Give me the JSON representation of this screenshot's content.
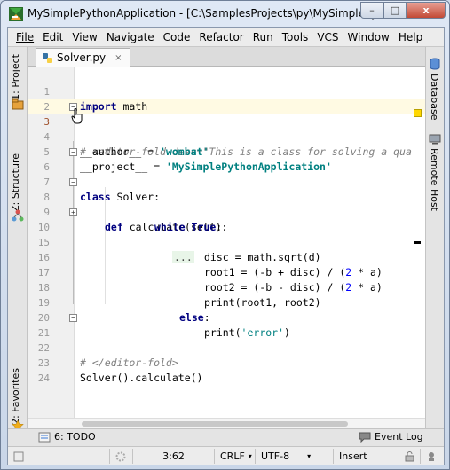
{
  "window": {
    "title": "MySimplePythonApplication - [C:\\SamplesProjects\\py\\MySimplePyt...",
    "minimize": "–",
    "maximize": "□",
    "close": "x"
  },
  "menu": {
    "items": [
      "File",
      "Edit",
      "View",
      "Navigate",
      "Code",
      "Refactor",
      "Run",
      "Tools",
      "VCS",
      "Window",
      "Help"
    ]
  },
  "left_tools": {
    "project": "1: Project",
    "structure": "Z: Structure",
    "favorites": "2: Favorites"
  },
  "right_tools": {
    "database": "Database",
    "remote_host": "Remote Host"
  },
  "editor_tab": {
    "label": "Solver.py",
    "close": "×"
  },
  "code": {
    "lines": [
      {
        "n": "1",
        "text": "import math"
      },
      {
        "n": "2",
        "text": ""
      },
      {
        "n": "3",
        "text": "# <editor-fold desc=\"This is a class for solving a qua"
      },
      {
        "n": "4",
        "text": "__author__ = 'wombat'"
      },
      {
        "n": "5",
        "text": "__project__ = 'MySimplePythonApplication'"
      },
      {
        "n": "6",
        "text": "class Solver:"
      },
      {
        "n": "7",
        "text": ""
      },
      {
        "n": "8",
        "text": "    def calculate(self):"
      },
      {
        "n": "9",
        "text": "        while True:"
      },
      {
        "n": "10",
        "text": "..."
      },
      {
        "n": "15",
        "text": "disc = math.sqrt(d)"
      },
      {
        "n": "16",
        "text": "root1 = (-b + disc) / (2 * a)"
      },
      {
        "n": "17",
        "text": "root2 = (-b - disc) / (2 * a)"
      },
      {
        "n": "18",
        "text": "print(root1, root2)"
      },
      {
        "n": "19",
        "text": "else:"
      },
      {
        "n": "20",
        "text": "print('error')"
      },
      {
        "n": "21",
        "text": "# </editor-fold>"
      },
      {
        "n": "22",
        "text": ""
      },
      {
        "n": "23",
        "text": "Solver().calculate()"
      },
      {
        "n": "24",
        "text": ""
      }
    ],
    "frag": {
      "import_kw": "import",
      "import_rest": " math",
      "fold_comment": "# <editor-fold desc=\"This is a class for solving a qua",
      "author_name": "__author__",
      "author_eq": " = ",
      "author_val": "'wombat'",
      "project_name": "__project__",
      "project_eq": " = ",
      "project_val": "'MySimplePythonApplication'",
      "class_kw": "class",
      "class_rest": " Solver:",
      "def_kw": "def",
      "def_rest": " calculate(self):",
      "while_kw": "while",
      "true_kw": " True",
      "while_colon": ":",
      "dots": "...",
      "disc": "disc = math.sqrt(d)",
      "root1_a": "root1 = (-b + disc) / (",
      "root1_2": "2",
      "root1_b": " * a)",
      "root2_a": "root2 = (-b - disc) / (",
      "root2_2": "2",
      "root2_b": " * a)",
      "print1": "print(root1, root2)",
      "else_kw": "else",
      "else_colon": ":",
      "print2_a": "print(",
      "print2_s": "'error'",
      "print2_b": ")",
      "endfold": "# </editor-fold>",
      "solver_call": "Solver().calculate()"
    }
  },
  "bottom_tools": {
    "todo": "6: TODO",
    "event_log": "Event Log"
  },
  "status": {
    "position": "3:62",
    "line_sep": "CRLF",
    "encoding": "UTF-8",
    "mode": "Insert"
  },
  "colors": {
    "keyword": "#000080",
    "string": "#008080",
    "number": "#0000ff",
    "comment": "#808080",
    "caret_row": "#fffae3"
  }
}
